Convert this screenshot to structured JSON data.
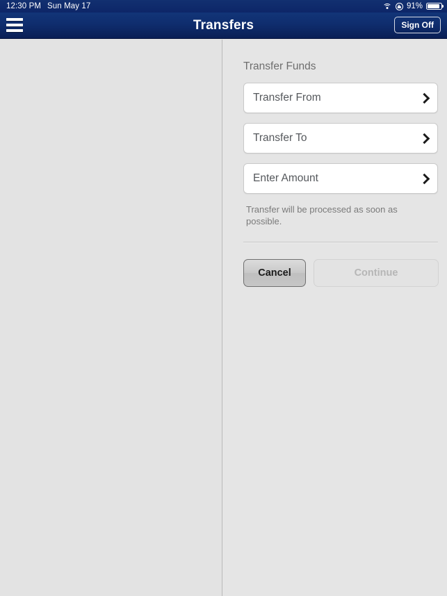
{
  "status_bar": {
    "time": "12:30 PM",
    "date": "Sun May 17",
    "battery_percent": "91%",
    "wifi_icon": "wifi-icon",
    "rotation_lock_icon": "rotation-lock-icon",
    "battery_icon": "battery-icon"
  },
  "nav_bar": {
    "title": "Transfers",
    "menu_icon": "hamburger-menu-icon",
    "sign_off_label": "Sign Off",
    "background_color": "#0f2d6e",
    "text_color": "#ffffff"
  },
  "detail": {
    "section_title": "Transfer Funds",
    "rows": [
      {
        "label": "Transfer From",
        "icon": "chevron-right-icon"
      },
      {
        "label": "Transfer To",
        "icon": "chevron-right-icon"
      },
      {
        "label": "Enter Amount",
        "icon": "chevron-right-icon"
      }
    ],
    "helper_text": "Transfer will be processed as soon as possible.",
    "buttons": {
      "cancel_label": "Cancel",
      "continue_label": "Continue",
      "continue_enabled": false
    }
  },
  "colors": {
    "page_background": "#e4e4e4",
    "navy": "#0f2d6e",
    "field_background": "#ffffff",
    "field_border": "#c9c9c9",
    "muted_text": "#7a7a7a",
    "disabled_text": "#b6b6b6"
  }
}
